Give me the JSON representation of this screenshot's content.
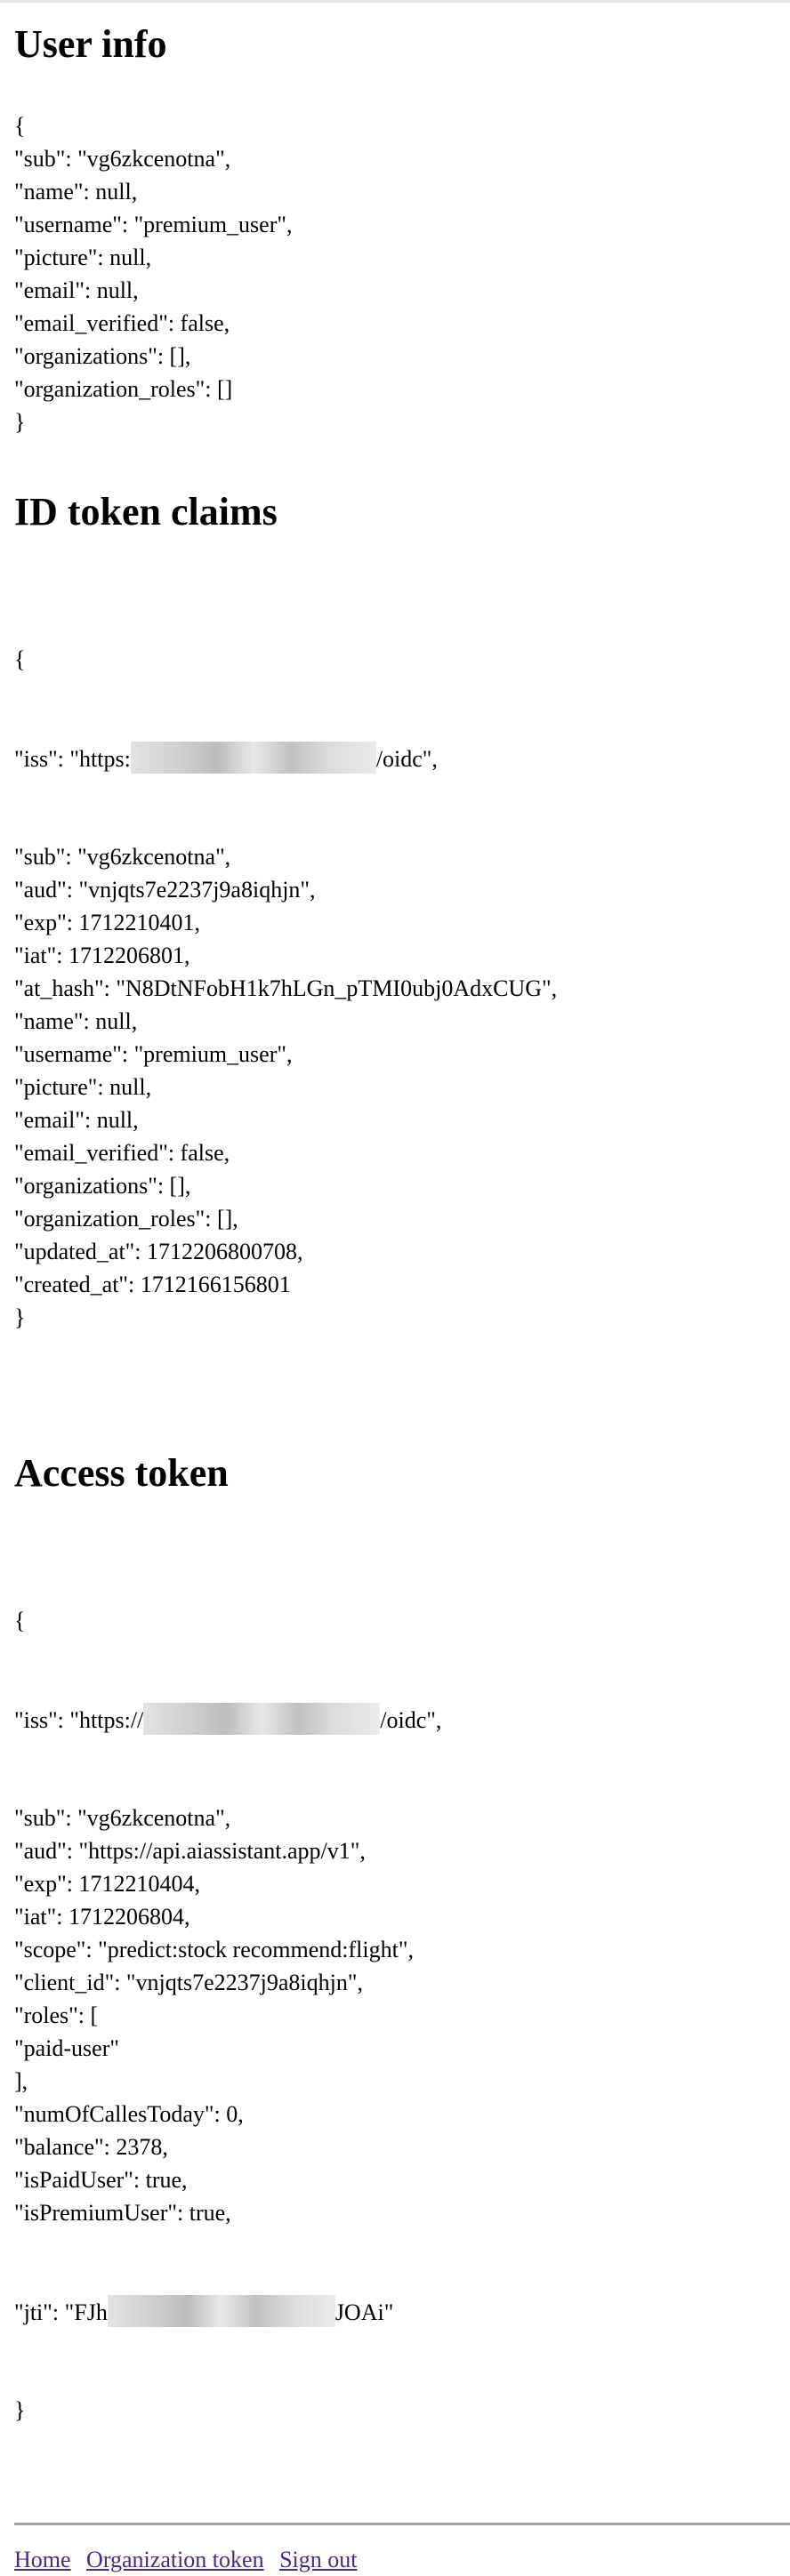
{
  "sections": [
    {
      "title": "User info",
      "lines": [
        "{",
        "\"sub\": \"vg6zkcenotna\",",
        "\"name\": null,",
        "\"username\": \"premium_user\",",
        "\"picture\": null,",
        "\"email\": null,",
        "\"email_verified\": false,",
        "\"organizations\": [],",
        "\"organization_roles\": []",
        "}"
      ]
    },
    {
      "title": "ID token claims",
      "iss_prefix": "\"iss\": \"https:",
      "iss_suffix": "/oidc\",",
      "lines_before": [
        "{"
      ],
      "lines_after": [
        "\"sub\": \"vg6zkcenotna\",",
        "\"aud\": \"vnjqts7e2237j9a8iqhjn\",",
        "\"exp\": 1712210401,",
        "\"iat\": 1712206801,",
        "\"at_hash\": \"N8DtNFobH1k7hLGn_pTMI0ubj0AdxCUG\",",
        "\"name\": null,",
        "\"username\": \"premium_user\",",
        "\"picture\": null,",
        "\"email\": null,",
        "\"email_verified\": false,",
        "\"organizations\": [],",
        "\"organization_roles\": [],",
        "\"updated_at\": 1712206800708,",
        "\"created_at\": 1712166156801",
        "}"
      ]
    },
    {
      "title": "Access token",
      "iss_prefix": "\"iss\": \"https://",
      "iss_suffix": "/oidc\",",
      "lines_before": [
        "{"
      ],
      "lines_mid": [
        "\"sub\": \"vg6zkcenotna\",",
        "\"aud\": \"https://api.aiassistant.app/v1\",",
        "\"exp\": 1712210404,",
        "\"iat\": 1712206804,",
        "\"scope\": \"predict:stock recommend:flight\",",
        "\"client_id\": \"vnjqts7e2237j9a8iqhjn\",",
        "\"roles\": [",
        "\"paid-user\"",
        "],",
        "\"numOfCallesToday\": 0,",
        "\"balance\": 2378,",
        "\"isPaidUser\": true,",
        "\"isPremiumUser\": true,"
      ],
      "jti_prefix": "\"jti\": \"FJh",
      "jti_suffix": "JOAi\"",
      "lines_after": [
        "}"
      ]
    }
  ],
  "footer": {
    "links": [
      "Home",
      "Organization token",
      "Sign out"
    ],
    "link_color": "#4b2a7d"
  }
}
